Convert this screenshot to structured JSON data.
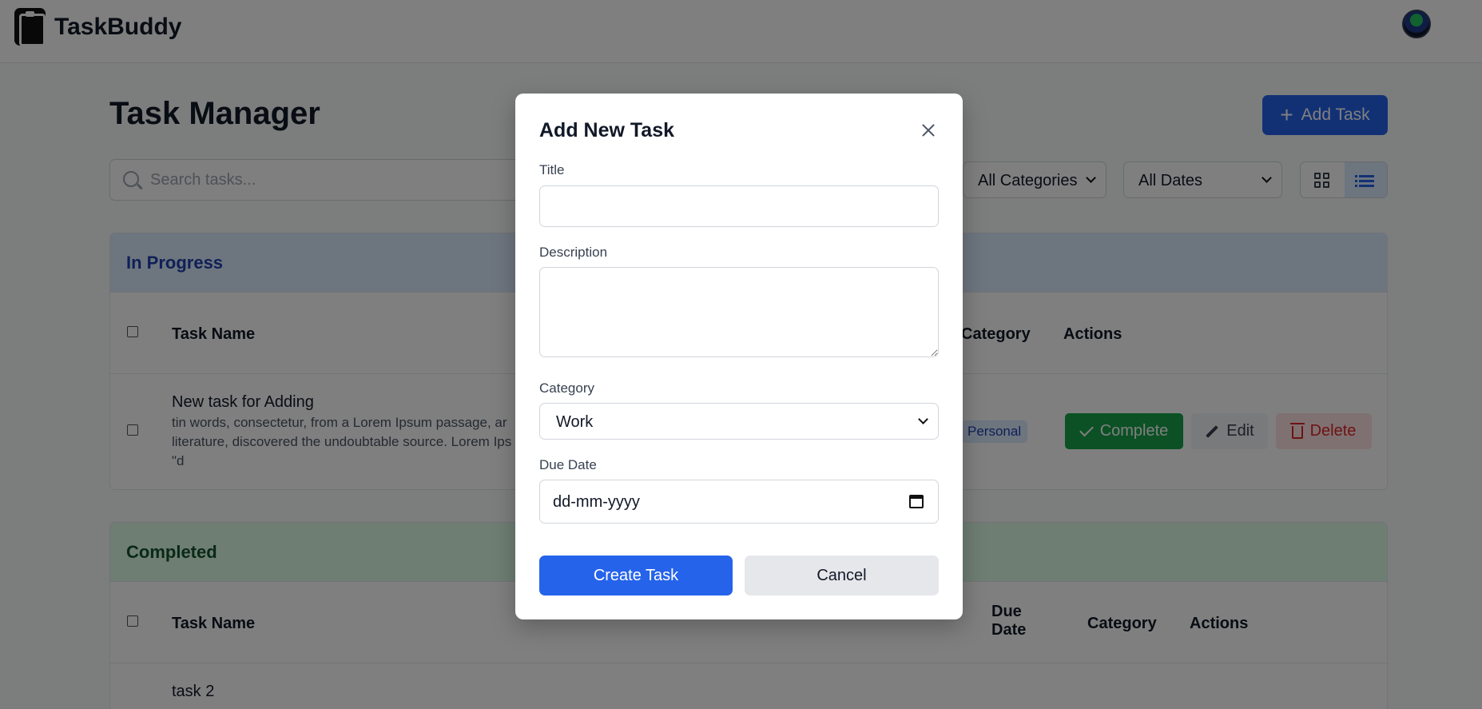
{
  "header": {
    "brand": "TaskBuddy",
    "logo_icon": "clipboard-icon",
    "avatar_icon": "user-avatar"
  },
  "page": {
    "title": "Task Manager",
    "add_task_label": "Add Task",
    "search_placeholder": "Search tasks...",
    "filters": {
      "category": "All Categories",
      "date": "All Dates"
    },
    "view_modes": [
      "grid",
      "list"
    ],
    "active_view": "list"
  },
  "in_progress": {
    "heading": "In Progress",
    "columns": {
      "name": "Task Name",
      "category": "Category",
      "actions": "Actions"
    },
    "tasks": [
      {
        "title": "New task for Adding",
        "desc_line1": "tin words, consectetur, from a Lorem Ipsum passage, ar",
        "desc_line2": "literature, discovered the undoubtable source. Lorem Ips",
        "desc_line3": "\"d",
        "category": "Personal"
      }
    ],
    "actions": {
      "complete": "Complete",
      "edit": "Edit",
      "delete": "Delete"
    }
  },
  "completed": {
    "heading": "Completed",
    "columns": {
      "name": "Task Name",
      "due_line1": "Due",
      "due_line2": "Date",
      "category": "Category",
      "actions": "Actions"
    },
    "tasks": [
      {
        "title": "task 2"
      }
    ]
  },
  "modal": {
    "title": "Add New Task",
    "title_label": "Title",
    "title_value": "",
    "description_label": "Description",
    "description_value": "",
    "category_label": "Category",
    "category_value": "Work",
    "due_label": "Due Date",
    "due_placeholder": "dd-mm-yyyy",
    "create_label": "Create Task",
    "cancel_label": "Cancel"
  },
  "colors": {
    "primary": "#2563eb",
    "success": "#16a34a",
    "danger": "#dc2626",
    "overlay": "rgba(0,0,0,0.5)"
  }
}
